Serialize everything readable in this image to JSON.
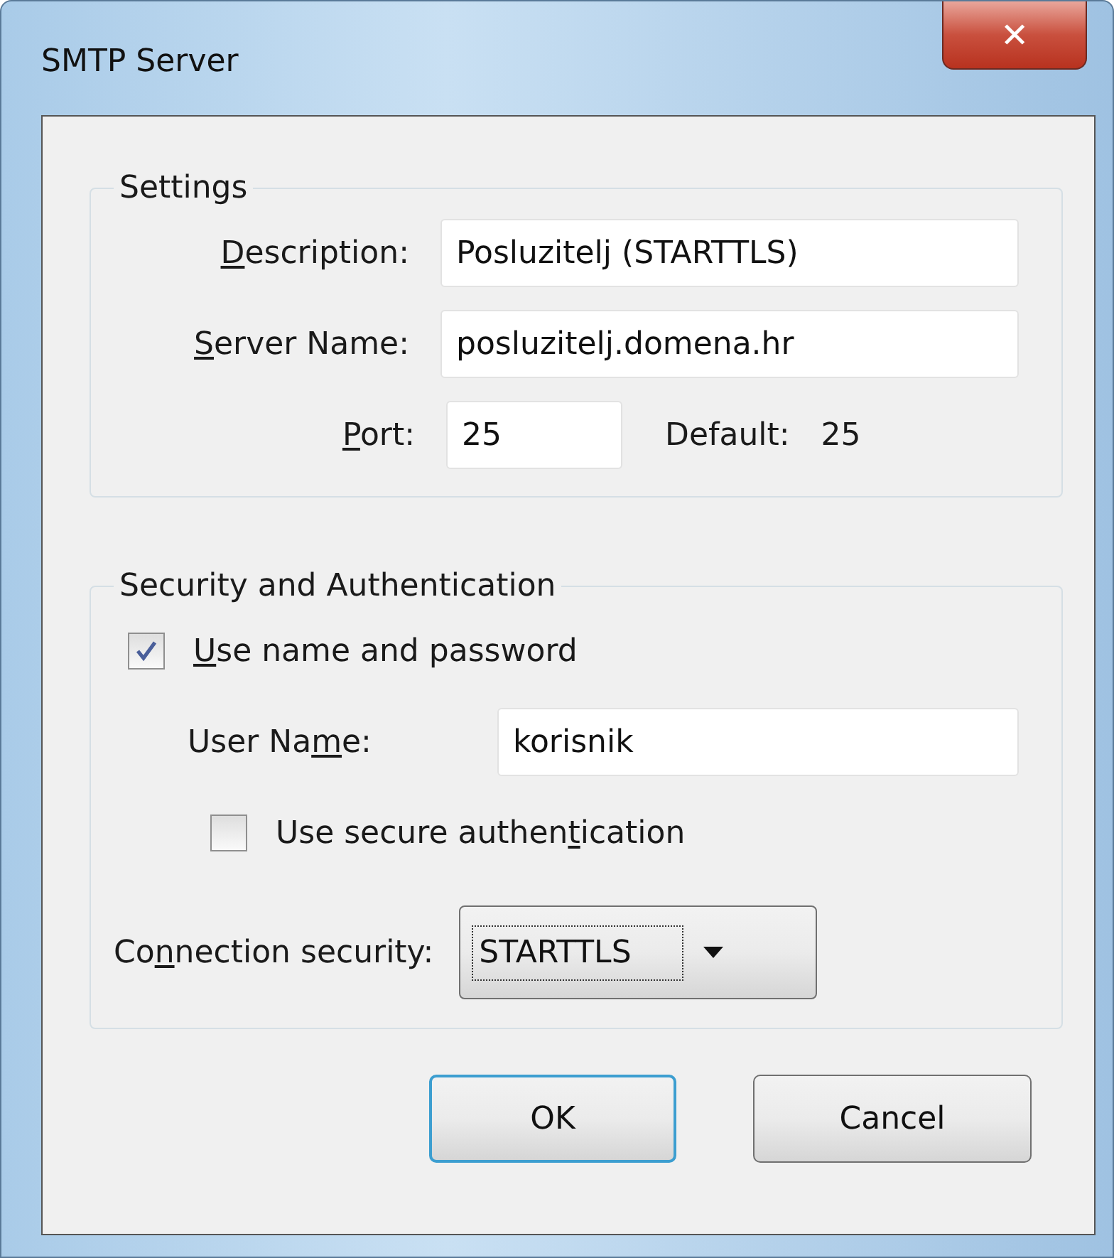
{
  "window": {
    "title": "SMTP Server",
    "close": "✕"
  },
  "settings": {
    "legend": "Settings",
    "description": {
      "label": {
        "key": "D",
        "after": "escription:"
      },
      "value": "Posluzitelj (STARTTLS)"
    },
    "server_name": {
      "label": {
        "key": "S",
        "after": "erver Name:"
      },
      "value": "posluzitelj.domena.hr"
    },
    "port": {
      "label": {
        "key": "P",
        "after": "ort:"
      },
      "value": "25",
      "default_label": "Default:",
      "default_value": "25"
    }
  },
  "security": {
    "legend": "Security and Authentication",
    "use_name": {
      "label": {
        "key": "U",
        "after": "se name and password"
      },
      "checked": true
    },
    "user_name": {
      "label": {
        "before": "User Na",
        "key": "m",
        "after": "e:"
      },
      "value": "korisnik"
    },
    "secure_auth": {
      "label": {
        "before": "Use secure authen",
        "key": "t",
        "after": "ication"
      },
      "checked": false
    },
    "connection": {
      "label": {
        "before": "Co",
        "key": "n",
        "after": "nection security:"
      },
      "value": "STARTTLS"
    }
  },
  "buttons": [
    {
      "label": "OK",
      "default": true
    },
    {
      "label": "Cancel",
      "default": false
    }
  ]
}
